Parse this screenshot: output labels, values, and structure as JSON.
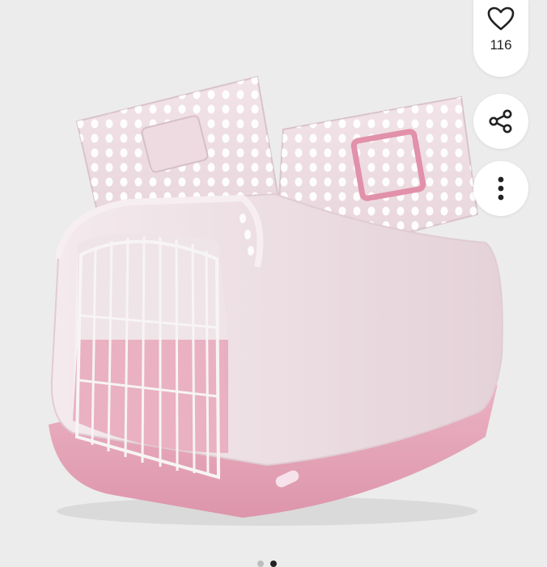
{
  "listing": {
    "like_count": "116",
    "icons": {
      "like": "heart-icon",
      "share": "share-icon",
      "more": "more-vertical-icon"
    },
    "colors": {
      "carrier_body": "#eddde2",
      "carrier_base": "#e7a9bb",
      "background": "#ececec",
      "button_bg": "#ffffff"
    },
    "gallery": {
      "image_count": 2,
      "active_index": 1
    }
  }
}
